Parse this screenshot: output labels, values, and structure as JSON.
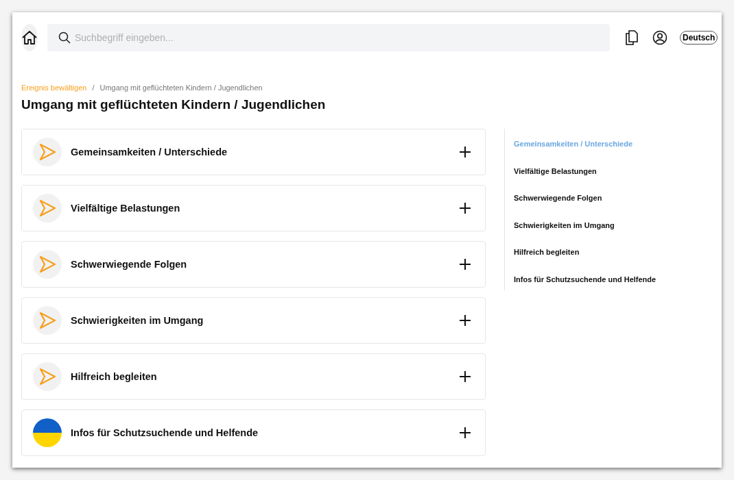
{
  "header": {
    "search": {
      "placeholder": "Suchbegriff eingeben..."
    },
    "language": "Deutsch"
  },
  "breadcrumb": [
    {
      "label": "Ereignis bewältigen",
      "kind": "link"
    },
    {
      "label": "/",
      "kind": "separator"
    },
    {
      "label": "Umgang mit geflüchteten Kindern / Jugendlichen",
      "kind": "current"
    }
  ],
  "title": "Umgang mit geflüchteten Kindern / Jugendlichen",
  "sections": [
    {
      "label": "Gemeinsamkeiten / Unterschiede",
      "kind": "arrow",
      "expanded": false
    },
    {
      "label": "Vielfältige Belastungen",
      "kind": "arrow",
      "expanded": false
    },
    {
      "label": "Schwerwiegende Folgen",
      "kind": "arrow",
      "expanded": false
    },
    {
      "label": "Schwierigkeiten im Umgang",
      "kind": "arrow",
      "expanded": false
    },
    {
      "label": "Hilfreich begleiten",
      "kind": "arrow",
      "expanded": false
    },
    {
      "label": "Infos für Schutzsuchende und Helfende",
      "kind": "flag",
      "expanded": false
    }
  ],
  "toc": [
    {
      "label": "Gemeinsamkeiten / Unterschiede",
      "selected": true
    },
    {
      "label": "Vielfältige Belastungen",
      "selected": false
    },
    {
      "label": "Schwerwiegende Folgen",
      "selected": false
    },
    {
      "label": "Schwierigkeiten im Umgang",
      "selected": false
    },
    {
      "label": "Hilfreich begleiten",
      "selected": false
    },
    {
      "label": "Infos für Schutzsuchende und Helfende",
      "selected": false
    }
  ]
}
